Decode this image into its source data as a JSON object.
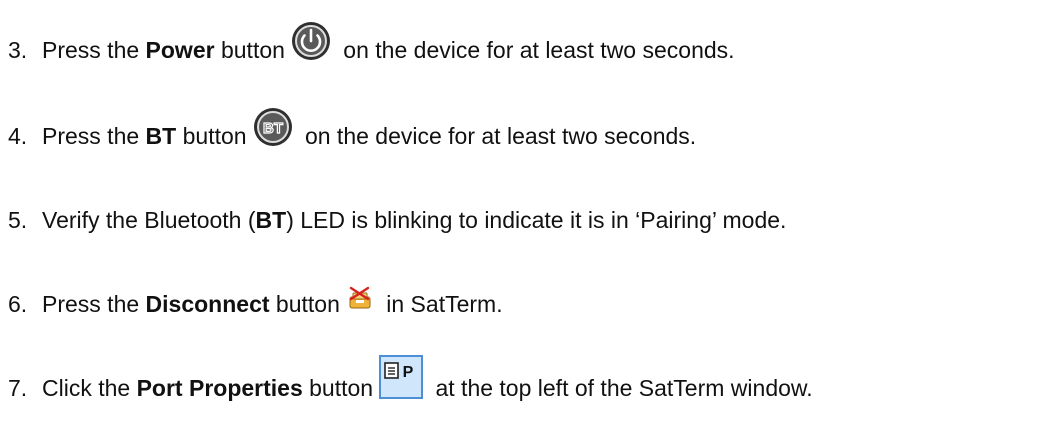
{
  "steps": [
    {
      "number": "3.",
      "pre": "Press the ",
      "bold": "Power",
      "mid": " button",
      "post": " on the device for at least two seconds.",
      "icon": "power-icon"
    },
    {
      "number": "4.",
      "pre": "Press the ",
      "bold": "BT",
      "mid": " button",
      "post": " on the device for at least two seconds.",
      "icon": "bluetooth-bt-icon",
      "icon_text": "BT"
    },
    {
      "number": "5.",
      "pre": "Verify the Bluetooth (",
      "bold": "BT",
      "post": ") LED is blinking to indicate it is in ‘Pairing’ mode."
    },
    {
      "number": "6.",
      "pre": "Press the ",
      "bold": "Disconnect",
      "mid": " button",
      "post": " in SatTerm.",
      "icon": "disconnect-icon"
    },
    {
      "number": "7.",
      "pre": "Click the ",
      "bold": "Port Properties",
      "mid": " button",
      "post": " at the top left of the SatTerm window.",
      "icon": "port-properties-icon",
      "icon_text": "P"
    }
  ],
  "colors": {
    "text": "#111111",
    "icon_dark": "#3a3a3a",
    "port_button_fill": "#cfe6fb",
    "port_button_border": "#4d8fd6"
  }
}
